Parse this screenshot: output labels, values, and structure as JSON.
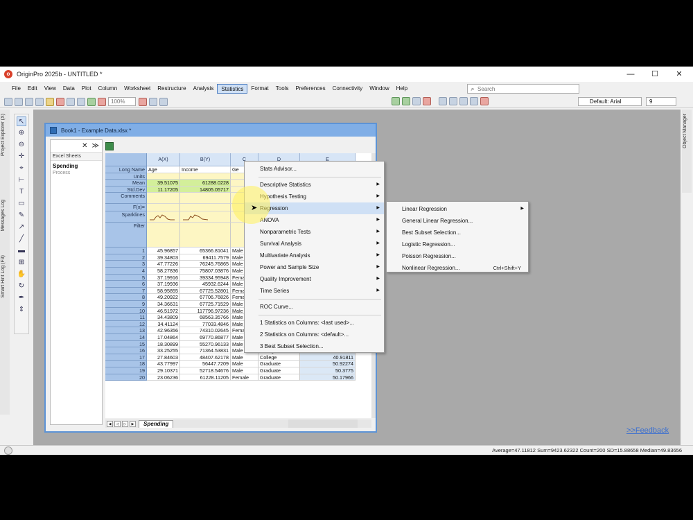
{
  "app": {
    "title": "OriginPro 2025b - UNTITLED *"
  },
  "window_controls": {
    "minimize": "—",
    "maximize": "☐",
    "close": "✕"
  },
  "menubar": [
    "File",
    "Edit",
    "View",
    "Data",
    "Plot",
    "Column",
    "Worksheet",
    "Restructure",
    "Analysis",
    "Statistics",
    "Format",
    "Tools",
    "Preferences",
    "Connectivity",
    "Window",
    "Help"
  ],
  "search": {
    "placeholder": "Search"
  },
  "toolbar": {
    "zoom": "100%",
    "font": "Default: Arial",
    "font_size": "9"
  },
  "side_tabs": {
    "left": [
      "Project Explorer (X)",
      "Messages Log",
      "Smart Hint Log (F3)"
    ],
    "right": "Object Manager"
  },
  "workbook": {
    "title": "Book1 - Example Data.xlsx *",
    "sheet_header": "Excel Sheets",
    "sheets": [
      "Spending",
      "Process"
    ],
    "active_tab": "Spending",
    "columns": [
      "A(X)",
      "B(Y)",
      "C",
      "D",
      "E"
    ],
    "meta_rows": [
      {
        "label": "Long Name",
        "cells": [
          "Age",
          "Income",
          "Ge",
          "",
          ""
        ]
      },
      {
        "label": "Units",
        "cells": [
          "",
          "",
          "",
          "",
          ""
        ]
      },
      {
        "label": "Mean",
        "cells": [
          "39.51075",
          "61288.0228",
          "",
          "",
          ""
        ]
      },
      {
        "label": "Std.Dev",
        "cells": [
          "11.17205",
          "14805.05717",
          "",
          "",
          ""
        ]
      },
      {
        "label": "Comments",
        "cells": [
          "",
          "",
          "",
          "",
          ""
        ]
      },
      {
        "label": "F(x)=",
        "cells": [
          "",
          "",
          "",
          "",
          ""
        ]
      },
      {
        "label": "Sparklines",
        "cells": [
          "",
          "",
          "",
          "",
          ""
        ]
      },
      {
        "label": "Filter",
        "cells": [
          "",
          "",
          "",
          "",
          ""
        ]
      }
    ],
    "rows": [
      [
        "1",
        "45.96857",
        "65366.81041",
        "Male",
        "",
        ""
      ],
      [
        "2",
        "39.34803",
        "69411.7579",
        "Male",
        "",
        ""
      ],
      [
        "3",
        "47.77226",
        "76245.76865",
        "Male",
        "",
        ""
      ],
      [
        "4",
        "58.27836",
        "75807.03876",
        "Male",
        "",
        ""
      ],
      [
        "5",
        "37.19916",
        "39334.95948",
        "Female",
        "Graduate",
        ""
      ],
      [
        "6",
        "37.19936",
        "45932.6244",
        "Male",
        "Graduate",
        "57.01236"
      ],
      [
        "7",
        "58.95855",
        "67725.52801",
        "Female",
        "Graduate",
        "55.10177"
      ],
      [
        "8",
        "49.20922",
        "67706.76826",
        "Female",
        "Graduate",
        "46.34734"
      ],
      [
        "9",
        "34.36631",
        "67725.71529",
        "Male",
        "Graduate",
        "70.70354"
      ],
      [
        "10",
        "46.51972",
        "117796.97236",
        "Male",
        "Graduate",
        "77.50677"
      ],
      [
        "11",
        "34.43809",
        "68563.35766",
        "Male",
        "College",
        "53.4727"
      ],
      [
        "12",
        "34.41124",
        "77033.4846",
        "Male",
        "Graduate",
        "61.36619"
      ],
      [
        "13",
        "42.96356",
        "74310.02645",
        "Female",
        "Graduate",
        "62.30487"
      ],
      [
        "14",
        "17.04864",
        "69770.86877",
        "Male",
        "HighSchool",
        "41.35716"
      ],
      [
        "15",
        "18.30899",
        "55270.96133",
        "Male",
        "College",
        "53.27456"
      ],
      [
        "16",
        "33.25255",
        "71364.53831",
        "Male",
        "College",
        "48.42842"
      ],
      [
        "17",
        "27.84603",
        "48407.62178",
        "Male",
        "College",
        "40.91811"
      ],
      [
        "18",
        "43.77997",
        "56447.7209",
        "Male",
        "Graduate",
        "50.92274"
      ],
      [
        "19",
        "29.10371",
        "52718.54676",
        "Male",
        "Graduate",
        "50.3775"
      ],
      [
        "20",
        "23.06236",
        "61228.11205",
        "Female",
        "Graduate",
        "50.17966"
      ]
    ]
  },
  "statistics_menu": {
    "items": [
      {
        "label": "Stats Advisor...",
        "submenu": false
      },
      {
        "sep": true
      },
      {
        "label": "Descriptive Statistics",
        "submenu": true
      },
      {
        "label": "Hypothesis Testing",
        "submenu": true
      },
      {
        "label": "Regression",
        "submenu": true,
        "highlight": true
      },
      {
        "label": "ANOVA",
        "submenu": true
      },
      {
        "label": "Nonparametric Tests",
        "submenu": true
      },
      {
        "label": "Survival Analysis",
        "submenu": true
      },
      {
        "label": "Multivariate Analysis",
        "submenu": true
      },
      {
        "label": "Power and Sample Size",
        "submenu": true
      },
      {
        "label": "Quality Improvement",
        "submenu": true
      },
      {
        "label": "Time Series",
        "submenu": true
      },
      {
        "sep": true
      },
      {
        "label": "ROC Curve...",
        "submenu": false
      },
      {
        "sep": true
      },
      {
        "label": "1 Statistics on Columns: <last used>...",
        "submenu": false
      },
      {
        "label": "2 Statistics on Columns: <default>...",
        "submenu": false
      },
      {
        "label": "3 Best Subset Selection...",
        "submenu": false
      }
    ]
  },
  "regression_menu": {
    "items": [
      {
        "label": "Linear Regression",
        "submenu": true,
        "shortcut": ""
      },
      {
        "label": "General Linear Regression...",
        "submenu": false,
        "shortcut": ""
      },
      {
        "label": "Best Subset Selection...",
        "submenu": false,
        "shortcut": ""
      },
      {
        "label": "Logistic Regression...",
        "submenu": false,
        "shortcut": ""
      },
      {
        "label": "Poisson Regression...",
        "submenu": false,
        "shortcut": ""
      },
      {
        "label": "Nonlinear Regression...",
        "submenu": false,
        "shortcut": "Ctrl+Shift+Y"
      }
    ]
  },
  "feedback_link": ">>Feedback",
  "status_bar": "Average=47.11812 Sum=9423.62322 Count=200 SD=15.88658 Median=49.83656",
  "colors": {
    "accent": "#80aee6",
    "menu_highlight": "#cfe0f5",
    "row_header": "#a8c4e8",
    "workspace": "#a9a9a9"
  }
}
